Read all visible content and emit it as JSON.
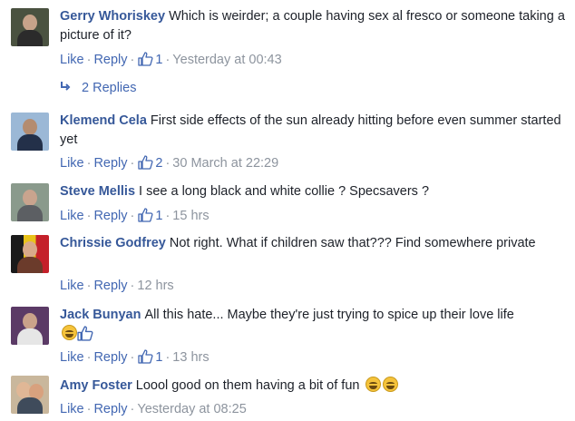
{
  "actions": {
    "like": "Like",
    "reply": "Reply",
    "separator": "·"
  },
  "comments": [
    {
      "author": "Gerry Whoriskey",
      "text": "Which is weirder; a couple having sex al fresco or someone taking a picture of it?",
      "likes": "1",
      "time": "Yesterday at 00:43",
      "replies": "2 Replies",
      "avatar": "man-dark-outdoor"
    },
    {
      "author": "Klemend Cela",
      "text": "First side effects of the sun already hitting before even summer started yet",
      "likes": "2",
      "time": "30 March at 22:29",
      "avatar": "man-suit-blue-background"
    },
    {
      "author": "Steve Mellis",
      "text": "I see a long black and white collie ? Specsavers ?",
      "likes": "1",
      "time": "15 hrs",
      "avatar": "man-grey-outdoor"
    },
    {
      "author": "Chrissie Godfrey",
      "text": "Not right. What if children saw that??? Find somewhere private",
      "likes": "",
      "time": "12 hrs",
      "avatar": "woman-flag-background"
    },
    {
      "author": "Jack Bunyan",
      "text": "All this hate... Maybe they're just trying to spice up their love life",
      "likes": "1",
      "time": "13 hrs",
      "avatar": "man-purple-background",
      "emoji": "laughing-face-and-thumbs-up"
    },
    {
      "author": "Amy Foster",
      "text": "Loool good on them having a bit of fun",
      "likes": "",
      "time": "Yesterday at 08:25",
      "avatar": "couple-selfie",
      "emoji": "two-laughing-faces"
    }
  ],
  "colors": {
    "author": "#365899",
    "link": "#4267b2",
    "meta": "#8d949e",
    "text": "#1d2129"
  }
}
